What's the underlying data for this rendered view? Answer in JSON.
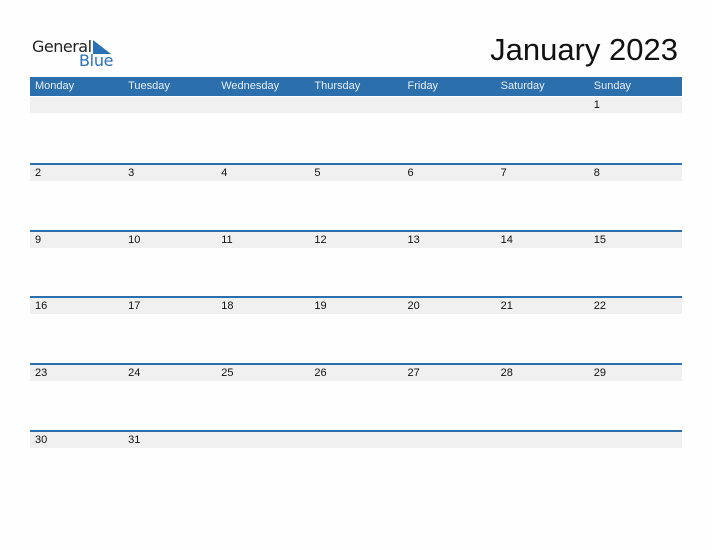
{
  "logo": {
    "line1": "General",
    "line2": "Blue"
  },
  "title": "January 2023",
  "weekdays": [
    "Monday",
    "Tuesday",
    "Wednesday",
    "Thursday",
    "Friday",
    "Saturday",
    "Sunday"
  ],
  "weeks": [
    [
      "",
      "",
      "",
      "",
      "",
      "",
      "1"
    ],
    [
      "2",
      "3",
      "4",
      "5",
      "6",
      "7",
      "8"
    ],
    [
      "9",
      "10",
      "11",
      "12",
      "13",
      "14",
      "15"
    ],
    [
      "16",
      "17",
      "18",
      "19",
      "20",
      "21",
      "22"
    ],
    [
      "23",
      "24",
      "25",
      "26",
      "27",
      "28",
      "29"
    ],
    [
      "30",
      "31",
      "",
      "",
      "",
      "",
      ""
    ]
  ],
  "colors": {
    "accent": "#2c6fad",
    "row_bg": "#f0f0f0"
  }
}
